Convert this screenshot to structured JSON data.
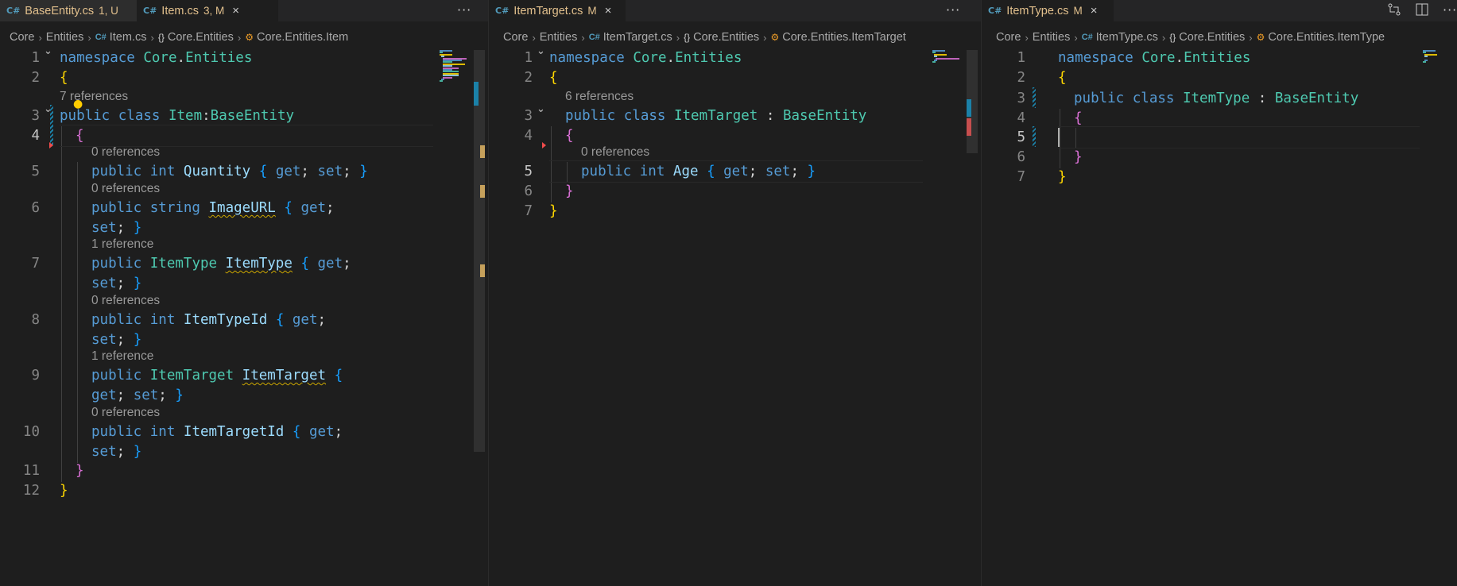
{
  "colors": {
    "background": "#1e1e1e",
    "tab_bar": "#252526",
    "keyword": "#569cd6",
    "type": "#4ec9b0",
    "identifier": "#9cdcfe",
    "bracket_level1": "#ffd700",
    "bracket_level2": "#da70d6",
    "bracket_level3": "#179fff",
    "modified_label": "#e2c08d",
    "line_number": "#858585",
    "codelens": "#999999"
  },
  "panes": [
    {
      "tabs": [
        {
          "icon": "csharp-file-icon",
          "name": "BaseEntity.cs",
          "status": "1, U",
          "active": false,
          "close": ""
        },
        {
          "icon": "csharp-file-icon",
          "name": "Item.cs",
          "status": "3, M",
          "active": true,
          "close": "×"
        }
      ],
      "more": "···",
      "breadcrumb": [
        {
          "icon": "",
          "text": "Core"
        },
        {
          "icon": "csharp-file-icon",
          "text": "Entities"
        },
        {
          "icon": "csharp-file-icon",
          "text": "Item.cs"
        },
        {
          "icon": "namespace-icon",
          "text": "Core.Entities"
        },
        {
          "icon": "class-icon",
          "text": "Core.Entities.Item"
        }
      ],
      "lines": [
        {
          "n": "1",
          "lens": "",
          "tokens": [
            [
              "kw",
              "namespace "
            ],
            [
              "ty",
              "Core"
            ],
            [
              "pl",
              "."
            ],
            [
              "ty",
              "Entities"
            ]
          ]
        },
        {
          "n": "2",
          "lens": "",
          "tokens": [
            [
              "b1",
              "{"
            ]
          ]
        },
        {
          "n": "3",
          "lens": "7 references",
          "tokens": [
            [
              "kw",
              "public class "
            ],
            [
              "ty",
              "Item"
            ],
            [
              "pl",
              ":"
            ],
            [
              "ty",
              "BaseEntity"
            ]
          ]
        },
        {
          "n": "4",
          "lens": "",
          "tokens": [
            [
              "b2",
              "{"
            ]
          ]
        },
        {
          "n": "5",
          "lens": "0 references",
          "tokens": [
            [
              "kw",
              "public int "
            ],
            [
              "id",
              "Quantity "
            ],
            [
              "b3",
              "{ "
            ],
            [
              "kw",
              "get"
            ],
            [
              "pl",
              "; "
            ],
            [
              "kw",
              "set"
            ],
            [
              "pl",
              "; "
            ],
            [
              "b3",
              "}"
            ]
          ]
        },
        {
          "n": "6",
          "lens": "0 references",
          "tokens": [
            [
              "kw",
              "public string "
            ],
            [
              "id",
              "ImageURL",
              "squig"
            ],
            [
              "pl",
              " "
            ],
            [
              "b3",
              "{ "
            ],
            [
              "kw",
              "get"
            ],
            [
              "pl",
              ";"
            ]
          ]
        },
        {
          "n": "",
          "lens": "",
          "tokens": [
            [
              "kw",
              "set"
            ],
            [
              "pl",
              "; "
            ],
            [
              "b3",
              "}"
            ]
          ]
        },
        {
          "n": "7",
          "lens": "1 reference",
          "tokens": [
            [
              "kw",
              "public "
            ],
            [
              "ty",
              "ItemType "
            ],
            [
              "id",
              "ItemType",
              "squig"
            ],
            [
              "pl",
              " "
            ],
            [
              "b3",
              "{ "
            ],
            [
              "kw",
              "get"
            ],
            [
              "pl",
              ";"
            ]
          ]
        },
        {
          "n": "",
          "lens": "",
          "tokens": [
            [
              "kw",
              "set"
            ],
            [
              "pl",
              "; "
            ],
            [
              "b3",
              "}"
            ]
          ]
        },
        {
          "n": "8",
          "lens": "0 references",
          "tokens": [
            [
              "kw",
              "public int "
            ],
            [
              "id",
              "ItemTypeId "
            ],
            [
              "b3",
              "{ "
            ],
            [
              "kw",
              "get"
            ],
            [
              "pl",
              ";"
            ]
          ]
        },
        {
          "n": "",
          "lens": "",
          "tokens": [
            [
              "kw",
              "set"
            ],
            [
              "pl",
              "; "
            ],
            [
              "b3",
              "}"
            ]
          ]
        },
        {
          "n": "9",
          "lens": "1 reference",
          "tokens": [
            [
              "kw",
              "public "
            ],
            [
              "ty",
              "ItemTarget "
            ],
            [
              "id",
              "ItemTarget",
              "squig"
            ],
            [
              "pl",
              " "
            ],
            [
              "b3",
              "{"
            ]
          ]
        },
        {
          "n": "",
          "lens": "",
          "tokens": [
            [
              "kw",
              "get"
            ],
            [
              "pl",
              "; "
            ],
            [
              "kw",
              "set"
            ],
            [
              "pl",
              "; "
            ],
            [
              "b3",
              "}"
            ]
          ]
        },
        {
          "n": "10",
          "lens": "0 references",
          "tokens": [
            [
              "kw",
              "public int "
            ],
            [
              "id",
              "ItemTargetId "
            ],
            [
              "b3",
              "{ "
            ],
            [
              "kw",
              "get"
            ],
            [
              "pl",
              ";"
            ]
          ]
        },
        {
          "n": "",
          "lens": "",
          "tokens": [
            [
              "kw",
              "set"
            ],
            [
              "pl",
              "; "
            ],
            [
              "b3",
              "}"
            ]
          ]
        },
        {
          "n": "11",
          "lens": "",
          "tokens": [
            [
              "b2",
              "}"
            ]
          ]
        },
        {
          "n": "12",
          "lens": "",
          "tokens": [
            [
              "b1",
              "}"
            ]
          ]
        }
      ]
    },
    {
      "tabs": [
        {
          "icon": "csharp-file-icon",
          "name": "ItemTarget.cs",
          "status": "M",
          "active": true,
          "close": "×"
        }
      ],
      "more": "···",
      "breadcrumb": [
        {
          "icon": "",
          "text": "Core"
        },
        {
          "icon": "csharp-file-icon",
          "text": "Entities"
        },
        {
          "icon": "csharp-file-icon",
          "text": "ItemTarget.cs"
        },
        {
          "icon": "namespace-icon",
          "text": "Core.Entities"
        },
        {
          "icon": "class-icon",
          "text": "Core.Entities.ItemTarget"
        }
      ],
      "lines": [
        {
          "n": "1",
          "lens": "",
          "tokens": [
            [
              "kw",
              "namespace "
            ],
            [
              "ty",
              "Core"
            ],
            [
              "pl",
              "."
            ],
            [
              "ty",
              "Entities"
            ]
          ]
        },
        {
          "n": "2",
          "lens": "",
          "tokens": [
            [
              "b1",
              "{"
            ]
          ]
        },
        {
          "n": "3",
          "lens": "6 references",
          "tokens": [
            [
              "kw",
              "public class "
            ],
            [
              "ty",
              "ItemTarget"
            ],
            [
              "pl",
              " : "
            ],
            [
              "ty",
              "BaseEntity"
            ]
          ]
        },
        {
          "n": "4",
          "lens": "",
          "tokens": [
            [
              "b2",
              "{"
            ]
          ]
        },
        {
          "n": "5",
          "lens": "0 references",
          "tokens": [
            [
              "kw",
              "public int "
            ],
            [
              "id",
              "Age "
            ],
            [
              "b3",
              "{ "
            ],
            [
              "kw",
              "get"
            ],
            [
              "pl",
              "; "
            ],
            [
              "kw",
              "set"
            ],
            [
              "pl",
              "; "
            ],
            [
              "b3",
              "}"
            ]
          ]
        },
        {
          "n": "6",
          "lens": "",
          "tokens": [
            [
              "b2",
              "}"
            ]
          ]
        },
        {
          "n": "7",
          "lens": "",
          "tokens": [
            [
              "b1",
              "}"
            ]
          ]
        }
      ]
    },
    {
      "tabs": [
        {
          "icon": "csharp-file-icon",
          "name": "ItemType.cs",
          "status": "M",
          "active": true,
          "close": "×"
        }
      ],
      "more": "",
      "breadcrumb": [
        {
          "icon": "",
          "text": "Core"
        },
        {
          "icon": "csharp-file-icon",
          "text": "Entities"
        },
        {
          "icon": "csharp-file-icon",
          "text": "ItemType.cs"
        },
        {
          "icon": "namespace-icon",
          "text": "Core.Entities"
        },
        {
          "icon": "class-icon",
          "text": "Core.Entities.ItemType"
        }
      ],
      "lines": [
        {
          "n": "1",
          "lens": "",
          "tokens": [
            [
              "kw",
              "namespace "
            ],
            [
              "ty",
              "Core"
            ],
            [
              "pl",
              "."
            ],
            [
              "ty",
              "Entities"
            ]
          ]
        },
        {
          "n": "2",
          "lens": "",
          "tokens": [
            [
              "b1",
              "{"
            ]
          ]
        },
        {
          "n": "3",
          "lens": "",
          "tokens": [
            [
              "kw",
              "public class "
            ],
            [
              "ty",
              "ItemType"
            ],
            [
              "pl",
              " : "
            ],
            [
              "ty",
              "BaseEntity"
            ]
          ]
        },
        {
          "n": "4",
          "lens": "",
          "tokens": [
            [
              "b2",
              "{"
            ]
          ]
        },
        {
          "n": "5",
          "lens": "",
          "tokens": []
        },
        {
          "n": "6",
          "lens": "",
          "tokens": [
            [
              "b2",
              "}"
            ]
          ]
        },
        {
          "n": "7",
          "lens": "",
          "tokens": [
            [
              "b1",
              "}"
            ]
          ]
        }
      ]
    }
  ]
}
